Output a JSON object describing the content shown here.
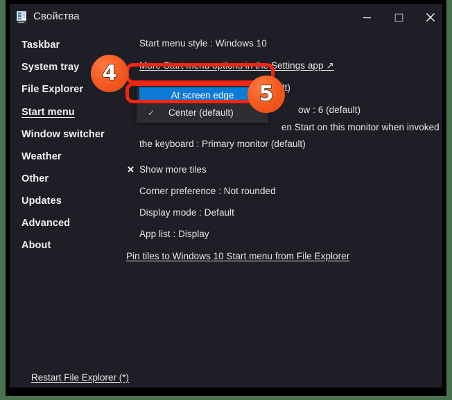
{
  "theme": {
    "outer_border_color": "#4a7250",
    "window_background": "#1e1f26",
    "accent_blue": "#0d7ad6",
    "annotation_red": "#f22613",
    "badge_orange": "#f4571f",
    "text_color": "#e6e6e6"
  },
  "window": {
    "title": "Свойства",
    "icon": "properties-icon",
    "controls": {
      "minimize": "minimize-icon",
      "maximize": "maximize-icon",
      "close": "close-icon"
    }
  },
  "sidebar": {
    "items": [
      {
        "label": "Taskbar",
        "active": false
      },
      {
        "label": "System tray",
        "active": false
      },
      {
        "label": "File Explorer",
        "active": false
      },
      {
        "label": "Start menu",
        "active": true
      },
      {
        "label": "Window switcher",
        "active": false
      },
      {
        "label": "Weather",
        "active": false
      },
      {
        "label": "Other",
        "active": false
      },
      {
        "label": "Updates",
        "active": false
      },
      {
        "label": "Advanced",
        "active": false
      },
      {
        "label": "About",
        "active": false
      }
    ]
  },
  "content": {
    "lines": [
      {
        "id": "start-menu-style",
        "text": "Start menu style : Windows 10"
      },
      {
        "id": "more-options-link",
        "text": "More Start menu options in the Settings app ↗"
      },
      {
        "id": "position-on-screen",
        "text": "Position on screen : Center (default)"
      },
      {
        "id": "number-of-columns",
        "text": "ow : 6 (default)"
      },
      {
        "id": "monitor-invoked",
        "text": "en Start on this monitor when invoked using"
      },
      {
        "id": "keyboard-monitor",
        "text": "the keyboard : Primary monitor (default)"
      },
      {
        "id": "show-more-tiles",
        "text": "Show more tiles"
      },
      {
        "id": "corner-preference",
        "text": "Corner preference : Not rounded"
      },
      {
        "id": "display-mode",
        "text": "Display mode : Default"
      },
      {
        "id": "app-list",
        "text": "App list : Display"
      },
      {
        "id": "pin-tiles-link",
        "text": "Pin tiles to Windows 10 Start menu from File Explorer"
      }
    ],
    "show_more_tiles_marker": "✕",
    "bottom_link": "Restart File Explorer (*)"
  },
  "dropdown": {
    "options": [
      {
        "label": "At screen edge",
        "selected": true,
        "checked": false
      },
      {
        "label": "Center (default)",
        "selected": false,
        "checked": true
      }
    ],
    "check_glyph": "✓"
  },
  "annotations": {
    "badges": [
      {
        "number": "4"
      },
      {
        "number": "5"
      }
    ],
    "highlight_count": 2
  }
}
